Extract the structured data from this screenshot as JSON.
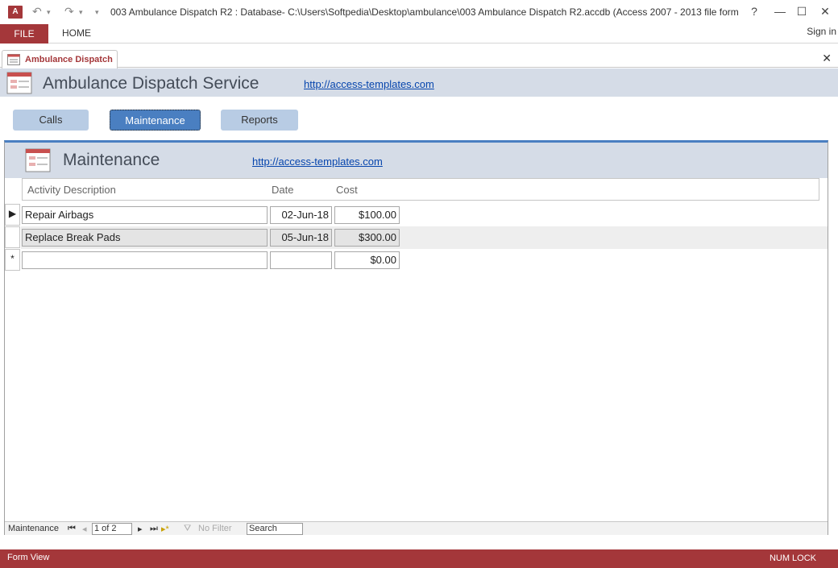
{
  "titlebar": {
    "app_icon": "access-icon",
    "title": "003 Ambulance Dispatch R2 : Database- C:\\Users\\Softpedia\\Desktop\\ambulance\\003 Ambulance Dispatch R2.accdb (Access 2007 - 2013 file form...",
    "help": "?",
    "minimize": "—",
    "maximize": "☐",
    "close": "✕"
  },
  "ribbon": {
    "file_label": "FILE",
    "home_label": "HOME",
    "sign_in": "Sign in"
  },
  "doc_tab": {
    "label": "Ambulance Dispatch",
    "close": "✕"
  },
  "form": {
    "title": "Ambulance Dispatch Service",
    "link": "http://access-templates.com",
    "nav": {
      "calls": "Calls",
      "maintenance": "Maintenance",
      "reports": "Reports"
    }
  },
  "subform": {
    "title": "Maintenance",
    "link": "http://access-templates.com",
    "columns": {
      "activity": "Activity Description",
      "date": "Date",
      "cost": "Cost"
    },
    "rows": [
      {
        "selector": "▶",
        "activity": "Repair Airbags",
        "date": "02-Jun-18",
        "cost": "$100.00"
      },
      {
        "selector": "",
        "activity": "Replace Break Pads",
        "date": "05-Jun-18",
        "cost": "$300.00"
      },
      {
        "selector": "*",
        "activity": "",
        "date": "",
        "cost": "$0.00"
      }
    ],
    "record_nav": {
      "label": "Maintenance",
      "position": "1 of 2",
      "filter": "No Filter",
      "search": "Search"
    }
  },
  "status": {
    "left": "Form View",
    "right": "NUM LOCK"
  },
  "colors": {
    "accent": "#a4373a",
    "header_bg": "#d5dce7",
    "active_button": "#4a7fc1",
    "button": "#b8cce4"
  }
}
